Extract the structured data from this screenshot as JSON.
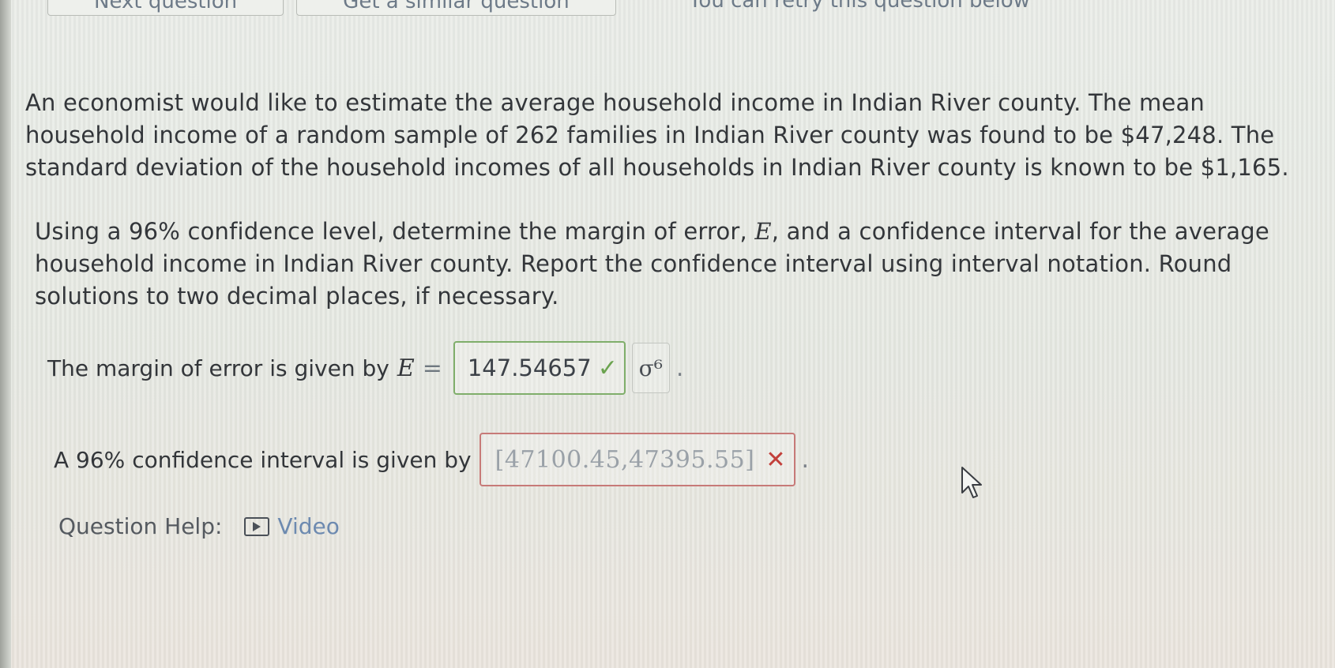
{
  "top_bar": {
    "next_question_label": "Next question",
    "similar_question_label": "Get a similar question",
    "retry_text": "You can retry this question below"
  },
  "problem": {
    "paragraph1": "An economist would like to estimate the average household income in Indian River county. The mean household income of a random sample of 262 families in Indian River county was found to be $47,248. The standard deviation of the household incomes of all households in Indian River county is known to be $1,165.",
    "paragraph2_before": "Using a 96% confidence level, determine the margin of error, ",
    "paragraph2_var": "E",
    "paragraph2_after": ", and a confidence interval for the average household income in Indian River county. Report the confidence interval using interval notation. Round solutions to two decimal places, if necessary."
  },
  "margin_row": {
    "label": "The margin of error is given by",
    "var": "E",
    "equals": "=",
    "answer": "147.54657",
    "status_icon": "check-icon",
    "sigma_button": "σ⁶",
    "period": "."
  },
  "interval_row": {
    "label": "A 96% confidence interval is given by",
    "answer": "[47100.45,47395.55]",
    "status_icon": "x-icon",
    "period": "."
  },
  "help": {
    "label": "Question Help:",
    "video_label": "Video"
  },
  "colors": {
    "correct": "#6ba34f",
    "incorrect": "#c23f3a",
    "link": "#6d8ab0"
  }
}
